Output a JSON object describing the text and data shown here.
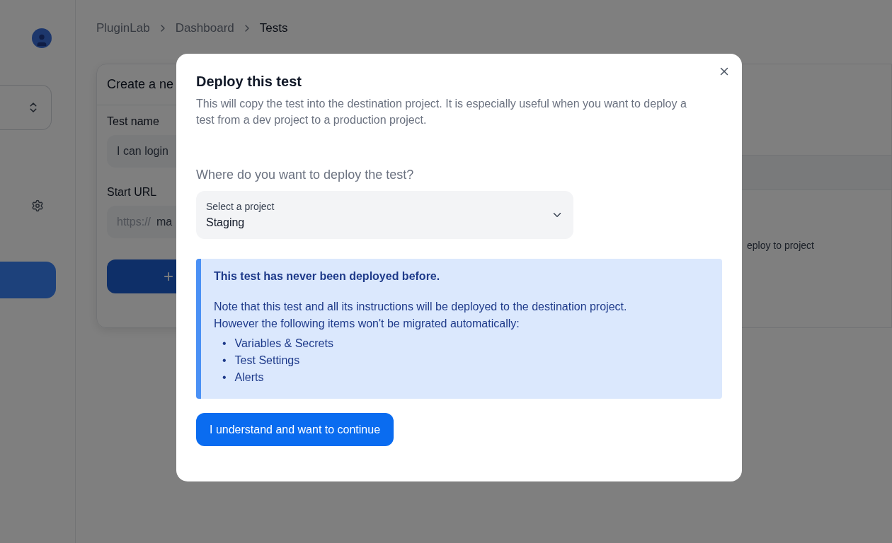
{
  "breadcrumb": [
    {
      "label": "PluginLab",
      "selected": false
    },
    {
      "label": "Dashboard",
      "selected": false
    },
    {
      "label": "Tests",
      "selected": true
    }
  ],
  "create_card": {
    "title": "Create a ne",
    "fields": [
      {
        "label": "Test name",
        "value": "I can login"
      },
      {
        "label": "Start URL",
        "prefix": "https://",
        "value": "ma"
      }
    ],
    "button": "+"
  },
  "side_panel": {
    "text": "eploy to project"
  },
  "modal": {
    "title": "Deploy this test",
    "description": "This will copy the test into the destination project. It is especially useful when you want to deploy a test from a dev project to a production project.",
    "question": "Where do you want to deploy the test?",
    "select": {
      "label": "Select a project",
      "value": "Staging"
    },
    "alert": {
      "title": "This test has never been deployed before.",
      "body": "Note that this test and all its instructions will be deployed to the destination project. However the following items won't be migrated automatically:",
      "bullet": "•",
      "items": [
        "Variables & Secrets",
        "Test Settings",
        "Alerts"
      ]
    },
    "button": "I understand and want to continue"
  }
}
